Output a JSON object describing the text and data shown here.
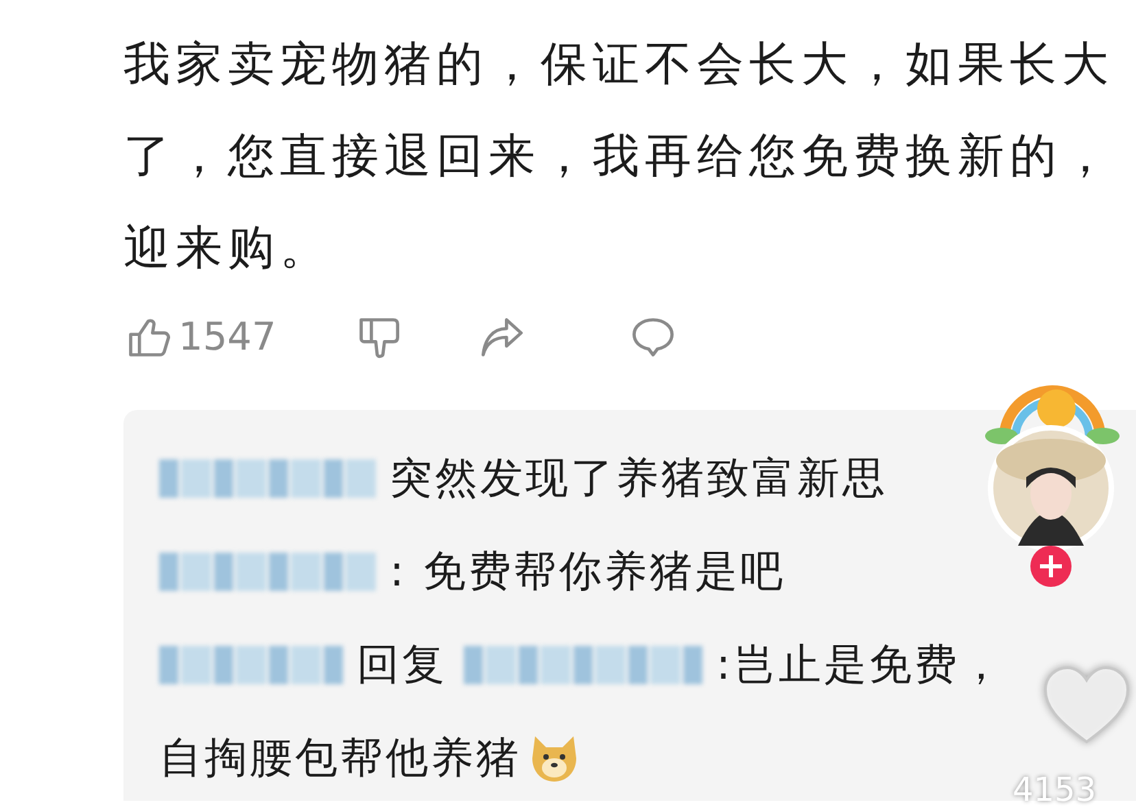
{
  "post": {
    "lines": [
      "我家卖宠物猪的，保证不会长大，如果长大",
      "了，您直接退回来，我再给您免费换新的，",
      "迎来购。"
    ]
  },
  "actions": [
    {
      "kind": "like",
      "count": "1547"
    },
    {
      "kind": "dislike"
    },
    {
      "kind": "share"
    },
    {
      "kind": "comment"
    }
  ],
  "replies": [
    {
      "kind": "comment",
      "text": "突然发现了养猪致富新思"
    },
    {
      "kind": "comment",
      "text": ": 免费帮你养猪是吧"
    },
    {
      "kind": "reply",
      "reply_word": "回复",
      "text": ":岂止是免费，",
      "continuation": "自掏腰包帮他养猪"
    }
  ],
  "overlay": {
    "like_count": "4153"
  }
}
